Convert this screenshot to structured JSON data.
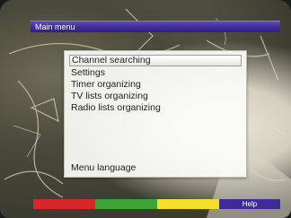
{
  "header": {
    "title": "Main menu"
  },
  "menu": {
    "items": [
      {
        "label": "Channel searching",
        "selected": true
      },
      {
        "label": "Settings",
        "selected": false
      },
      {
        "label": "Timer organizing",
        "selected": false
      },
      {
        "label": "TV lists organizing",
        "selected": false
      },
      {
        "label": "Radio lists organizing",
        "selected": false
      },
      {
        "label": "Menu language",
        "selected": false
      }
    ]
  },
  "color_keys": {
    "red": {
      "label": "",
      "color": "#d8262a"
    },
    "green": {
      "label": "",
      "color": "#3fa238"
    },
    "yellow": {
      "label": "",
      "color": "#f2e02c"
    },
    "blue": {
      "label": "Help",
      "color": "#3d2c98"
    }
  }
}
